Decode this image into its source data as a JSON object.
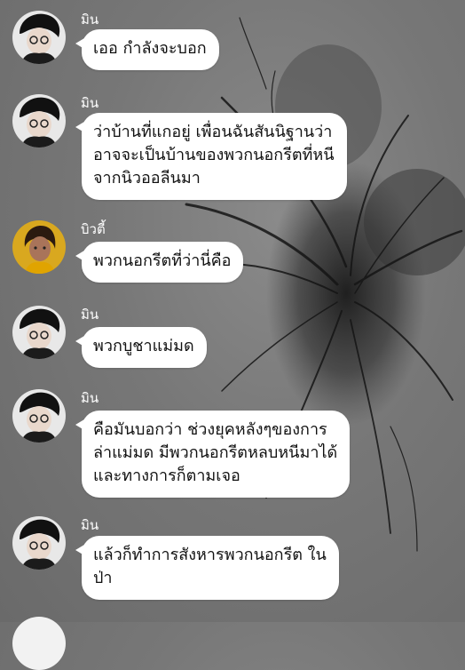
{
  "conversation": {
    "messages": [
      {
        "sender": "มิน",
        "text": "เออ กำลังจะบอก",
        "avatar": "avatar-min"
      },
      {
        "sender": "มิน",
        "text": "ว่าบ้านที่แกอยู่ เพื่อนฉันสันนิฐานว่า\nอาจจะเป็นบ้านของพวกนอกรีตที่หนี\nจากนิวออลีนมา",
        "avatar": "avatar-min"
      },
      {
        "sender": "บิวตี้",
        "text": "พวกนอกรีตที่ว่านี่คือ",
        "avatar": "avatar-beauty"
      },
      {
        "sender": "มิน",
        "text": "พวกบูชาแม่มด",
        "avatar": "avatar-min"
      },
      {
        "sender": "มิน",
        "text": "คือมันบอกว่า ช่วงยุคหลังๆของการ\nล่าแม่มด มีพวกนอกรีตหลบหนีมาได้\nและทางการก็ตามเจอ",
        "avatar": "avatar-min"
      },
      {
        "sender": "มิน",
        "text": "แล้วก็ทำการสังหารพวกนอกรีต ใน\nป่า",
        "avatar": "avatar-min"
      }
    ]
  },
  "colors": {
    "bubble": "#ffffff",
    "sender_label": "#ffffff",
    "background": "#777777"
  }
}
